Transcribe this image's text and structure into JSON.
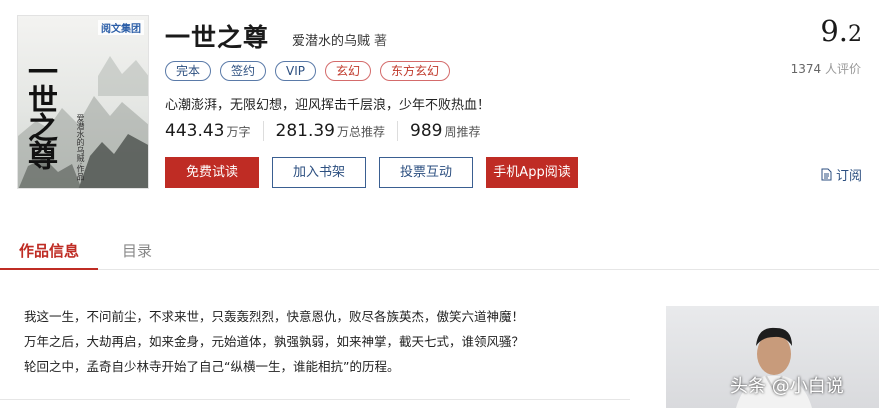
{
  "book": {
    "title": "一世之尊",
    "author": "爱潜水的乌贼",
    "author_suffix": "著",
    "tags": [
      {
        "label": "完本",
        "style": "blue"
      },
      {
        "label": "签约",
        "style": "blue"
      },
      {
        "label": "VIP",
        "style": "blue"
      },
      {
        "label": "玄幻",
        "style": "red"
      },
      {
        "label": "东方玄幻",
        "style": "red"
      }
    ],
    "tagline": "心潮澎湃，无限幻想，迎风挥击千层浪，少年不败热血！"
  },
  "cover": {
    "publisher": "阅文集团",
    "title_text": "一世之尊",
    "author_text": "爱潜水的乌贼·作品"
  },
  "stats": {
    "words": {
      "value": "443.43",
      "unit": "万字"
    },
    "total_rec": {
      "value": "281.39",
      "unit": "万总推荐"
    },
    "weekly_rec": {
      "value": "989",
      "unit": "周推荐"
    }
  },
  "actions": {
    "free_read": "免费试读",
    "add_shelf": "加入书架",
    "vote": "投票互动",
    "app_read": "手机App阅读"
  },
  "rating": {
    "score_int": "9.",
    "score_dec": "2",
    "count": "1374",
    "count_suffix": "人评价"
  },
  "subscribe": {
    "label": "订阅",
    "icon": "document-icon"
  },
  "tabs": [
    {
      "label": "作品信息",
      "active": true
    },
    {
      "label": "目录",
      "active": false
    }
  ],
  "description": [
    "我这一生，不问前尘，不求来世，只轰轰烈烈，快意恩仇，败尽各族英杰，傲笑六道神魔！",
    "万年之后，大劫再启，如来金身，元始道体，孰强孰弱，如来神掌，截天七式，谁领风骚？",
    "轮回之中，孟奇自少林寺开始了自己“纵横一生，谁能相抗”的历程。"
  ],
  "watermark": "头条 @小白说",
  "colors": {
    "accent_red": "#bf2c24",
    "link_blue": "#2c4f80"
  }
}
